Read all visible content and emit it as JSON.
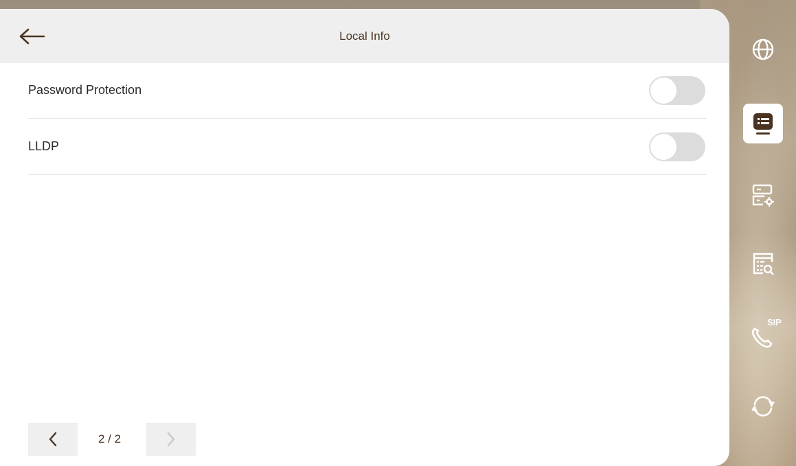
{
  "header": {
    "title": "Local Info"
  },
  "settings": [
    {
      "label": "Password Protection",
      "enabled": false
    },
    {
      "label": "LLDP",
      "enabled": false
    }
  ],
  "pagination": {
    "text": "2 / 2"
  },
  "sidebar": {
    "items": [
      {
        "icon": "globe-icon",
        "active": false
      },
      {
        "icon": "local-info-icon",
        "active": true
      },
      {
        "icon": "server-settings-icon",
        "active": false
      },
      {
        "icon": "system-search-icon",
        "active": false
      },
      {
        "icon": "sip-call-icon",
        "label": "SIP",
        "active": false
      },
      {
        "icon": "refresh-icon",
        "active": false
      }
    ]
  },
  "colors": {
    "accent": "#4a3320",
    "header_bg": "#efefef",
    "toggle_off": "#dcdcdc"
  }
}
